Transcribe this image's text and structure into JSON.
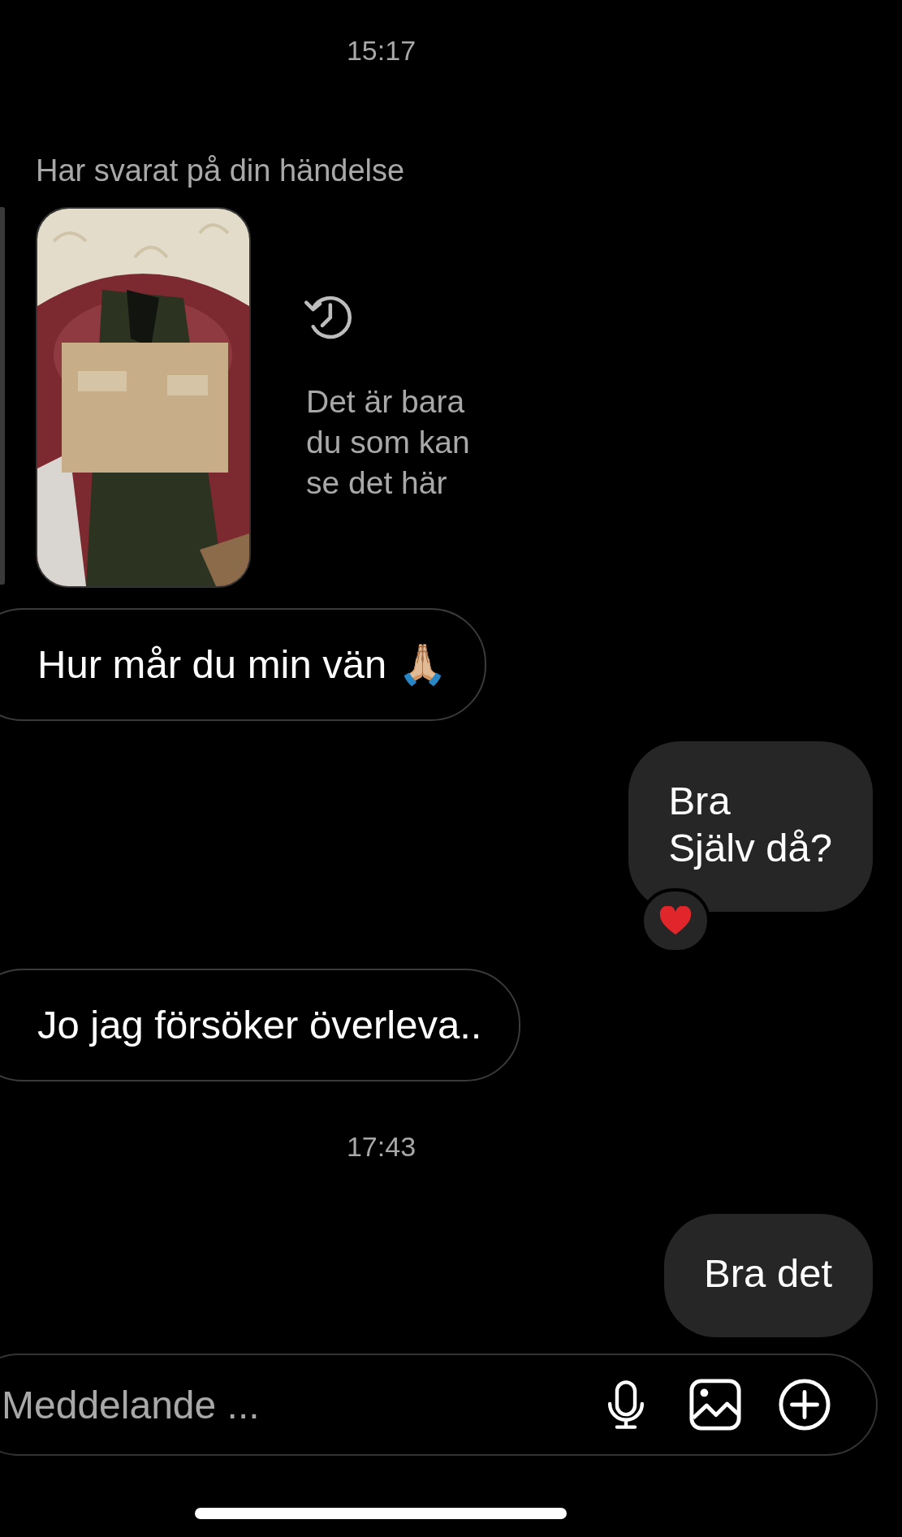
{
  "messages": [
    {
      "kind": "time",
      "text": "15:17"
    },
    {
      "kind": "story_reply",
      "label": "Har svarat på din händelse",
      "note": "Det är bara du som kan se det här"
    },
    {
      "kind": "text",
      "outgoing": false,
      "text": "Hur mår du min vän 🙏🏼"
    },
    {
      "kind": "text",
      "outgoing": true,
      "lines": [
        "Bra",
        "Själv då?"
      ],
      "reaction": {
        "kind": "heart"
      }
    },
    {
      "kind": "text",
      "outgoing": false,
      "text": "Jo jag försöker överleva.."
    },
    {
      "kind": "time",
      "text": "17:43"
    },
    {
      "kind": "text",
      "outgoing": true,
      "lines": [
        "Bra det"
      ]
    }
  ],
  "composer": {
    "placeholder": "Meddelande ..."
  }
}
